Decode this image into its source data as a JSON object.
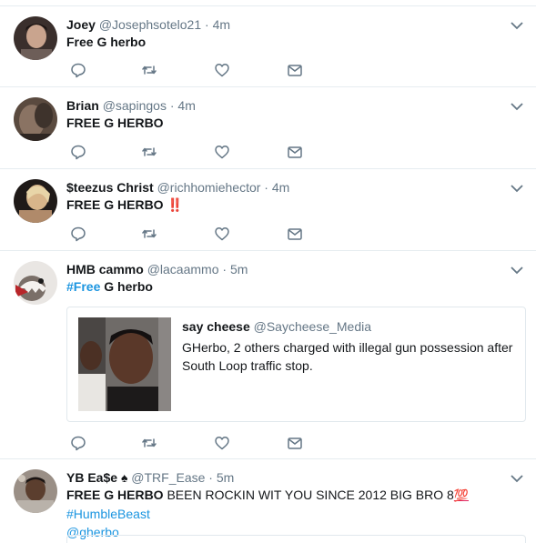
{
  "tweets": [
    {
      "name": "Joey",
      "handle": "@Josephsotelo21",
      "time": "4m",
      "text": "Free G herbo"
    },
    {
      "name": "Brian",
      "handle": "@sapingos",
      "time": "4m",
      "text": "FREE G HERBO"
    },
    {
      "name": "$teezus Christ",
      "handle": "@richhomiehector",
      "time": "4m",
      "text": "FREE G HERBO",
      "emoji": "‼️"
    },
    {
      "name": "HMB cammo",
      "handle": "@lacaammo",
      "time": "5m",
      "hashtag": "#Free",
      "text": " G herbo",
      "quote": {
        "name": "say cheese",
        "handle": "@Saycheese_Media",
        "text": "GHerbo, 2 others charged with illegal gun possession after South Loop traffic stop."
      }
    },
    {
      "name": "YB Ea$e",
      "name_emoji": "♠",
      "handle": "@TRF_Ease",
      "time": "5m",
      "text_bold": "FREE G HERBO",
      "text": " BEEN ROCKIN WIT YOU SINCE 2012 BIG BRO 8",
      "emoji": "💯",
      "hashtag": "#HumbleBeast",
      "mention": "@gherbo"
    }
  ],
  "separator": "·",
  "icons": [
    "reply-icon",
    "retweet-icon",
    "like-icon",
    "direct-message-icon",
    "chevron-down-icon"
  ],
  "colors": {
    "link": "#1b95e0",
    "muted": "#657786",
    "divider": "#e6ecf0",
    "icon": "#657786"
  }
}
